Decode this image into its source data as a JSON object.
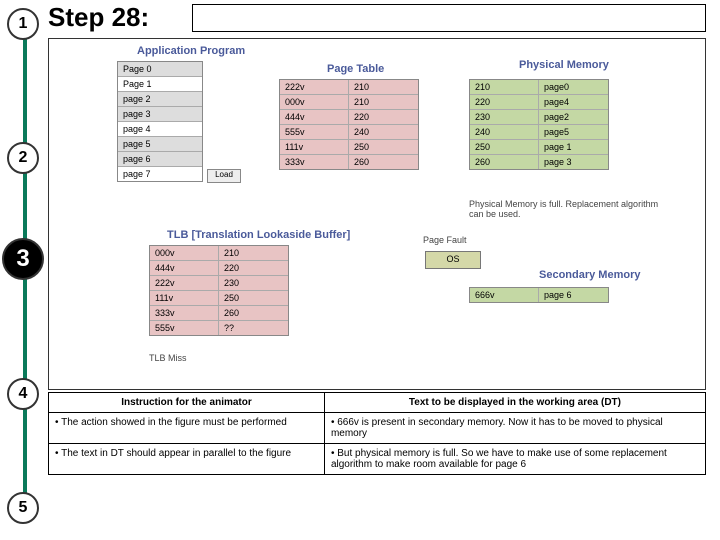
{
  "step_title": "Step 28:",
  "rail": [
    "1",
    "2",
    "3",
    "4",
    "5"
  ],
  "active_step": 3,
  "labels": {
    "ap": "Application Program",
    "pt": "Page Table",
    "pm": "Physical Memory",
    "tlb": "TLB [Translation Lookaside Buffer]",
    "sm": "Secondary Memory"
  },
  "ap": {
    "rows": [
      "Page 0",
      "Page 1",
      "page 2",
      "page 3",
      "page 4",
      "page 5",
      "page 6",
      "page 7"
    ],
    "load": "Load"
  },
  "pt": {
    "rows": [
      [
        "222v",
        "210"
      ],
      [
        "000v",
        "210"
      ],
      [
        "444v",
        "220"
      ],
      [
        "555v",
        "240"
      ],
      [
        "111v",
        "250"
      ],
      [
        "333v",
        "260"
      ]
    ]
  },
  "pm": {
    "rows": [
      [
        "210",
        "page0"
      ],
      [
        "220",
        "page4"
      ],
      [
        "230",
        "page2"
      ],
      [
        "240",
        "page5"
      ],
      [
        "250",
        "page 1"
      ],
      [
        "260",
        "page 3"
      ]
    ]
  },
  "tlb": {
    "rows": [
      [
        "000v",
        "210"
      ],
      [
        "444v",
        "220"
      ],
      [
        "222v",
        "230"
      ],
      [
        "111v",
        "250"
      ],
      [
        "333v",
        "260"
      ],
      [
        "555v",
        "??"
      ]
    ]
  },
  "sm": {
    "rows": [
      [
        "666v",
        "page 6"
      ]
    ]
  },
  "notes": {
    "pm_full": "Physical Memory is full. Replacement algorithm can be used.",
    "page_fault": "Page Fault",
    "tlb_miss": "TLB Miss"
  },
  "os": "OS",
  "bottom": {
    "h1": "Instruction for the animator",
    "h2": "Text to be displayed in the working area (DT)",
    "r1c1": "• The action showed in the figure must be performed",
    "r1c2": "• 666v is present in secondary memory. Now it has to be moved to physical memory",
    "r2c1": "• The text in DT should appear  in parallel to the figure",
    "r2c2": "• But physical memory is full. So we have to make use of some replacement algorithm to make room available for page 6"
  }
}
